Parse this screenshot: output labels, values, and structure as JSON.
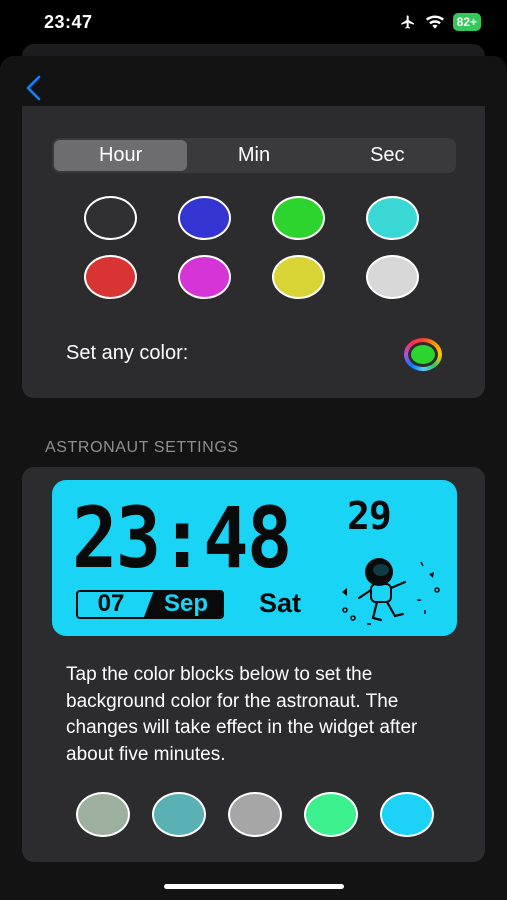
{
  "status_bar": {
    "time": "23:47",
    "battery": "82+"
  },
  "nav": {
    "back_icon": "chevron-left-icon",
    "accent": "#0a84ff"
  },
  "hand_picker": {
    "tabs": [
      {
        "label": "Hour",
        "selected": true
      },
      {
        "label": "Min",
        "selected": false
      },
      {
        "label": "Sec",
        "selected": false
      }
    ],
    "swatches": [
      {
        "name": "dark-gray",
        "color": "#303032"
      },
      {
        "name": "blue",
        "color": "#3434d2"
      },
      {
        "name": "green",
        "color": "#2ed42e"
      },
      {
        "name": "turquoise",
        "color": "#3ad8d5"
      },
      {
        "name": "red",
        "color": "#d83434"
      },
      {
        "name": "magenta",
        "color": "#d535d6"
      },
      {
        "name": "yellow",
        "color": "#d8d435"
      },
      {
        "name": "light-gray",
        "color": "#d8d8d8"
      }
    ],
    "any_color_label": "Set any color:",
    "any_color_value": "#2dd42d"
  },
  "astronaut": {
    "section_title": "ASTRONAUT SETTINGS",
    "widget": {
      "time": "23:48",
      "seconds": "29",
      "day": "07",
      "month": "Sep",
      "weekday": "Sat",
      "background": "#19d4f5"
    },
    "description": "Tap the color blocks below to set the background color for the astronaut. The changes will take effect in the widget after about five minutes.",
    "swatches": [
      {
        "name": "sage",
        "color": "#9db09d"
      },
      {
        "name": "teal",
        "color": "#5ab1b3"
      },
      {
        "name": "gray",
        "color": "#a6a6a6"
      },
      {
        "name": "mint",
        "color": "#3cf08e"
      },
      {
        "name": "sky-blue",
        "color": "#1cd2f6"
      }
    ]
  }
}
